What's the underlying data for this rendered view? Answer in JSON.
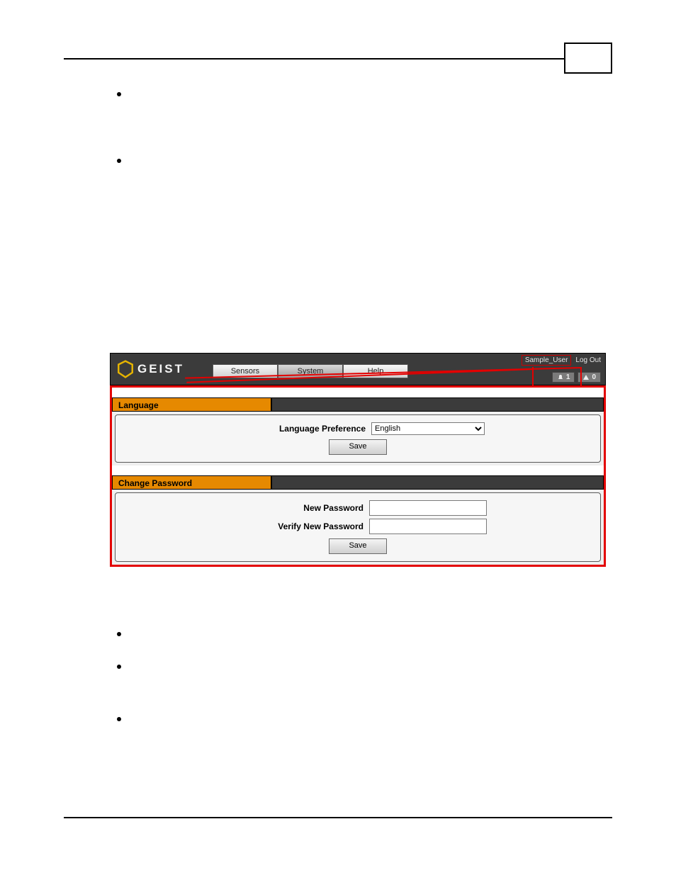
{
  "nav": {
    "logo_text": "GEIST",
    "tabs": [
      "Sensors",
      "System",
      "Help"
    ],
    "user_name": "Sample_User",
    "logout": "Log Out",
    "alarm_badge": "1",
    "warn_badge": "0"
  },
  "language": {
    "section_title": "Language",
    "pref_label": "Language Preference",
    "selected": "English",
    "save": "Save"
  },
  "password": {
    "section_title": "Change Password",
    "new_label": "New Password",
    "verify_label": "Verify New Password",
    "save": "Save"
  }
}
